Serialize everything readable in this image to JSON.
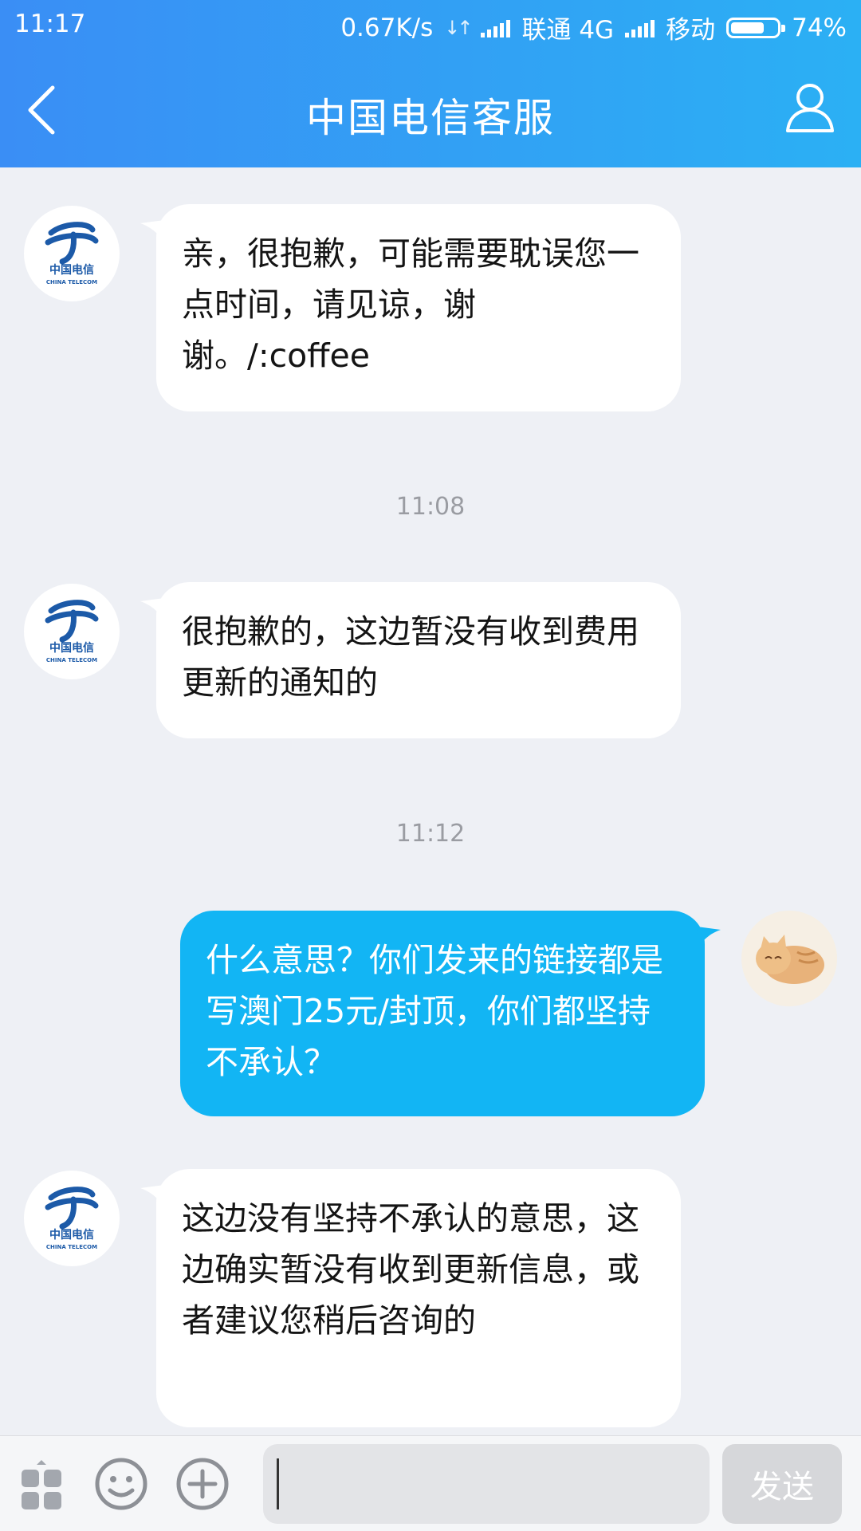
{
  "status_bar": {
    "time": "11:17",
    "network_speed": "0.67K/s",
    "carrier1": "联通 4G",
    "carrier2": "移动",
    "battery": "74%",
    "battery_level": 0.74
  },
  "header": {
    "title": "中国电信客服",
    "back_icon": "chevron-left-icon",
    "profile_icon": "person-outline-icon"
  },
  "agent_logo": {
    "text": "中国电信",
    "sub": "CHINA TELECOM",
    "color": "#1c5aa8"
  },
  "messages": [
    {
      "sender": "agent",
      "text": "亲，很抱歉，可能需要耽误您一点时间，请见谅，谢谢。/:coffee"
    },
    {
      "type": "timestamp",
      "text": "11:08"
    },
    {
      "sender": "agent",
      "text": "很抱歉的，这边暂没有收到费用更新的通知的"
    },
    {
      "type": "timestamp",
      "text": "11:12"
    },
    {
      "sender": "user",
      "text": "什么意思？你们发来的链接都是写澳门25元/封顶，你们都坚持不承认？"
    },
    {
      "sender": "agent",
      "text": "这边没有坚持不承认的意思，这边确实暂没有收到更新信息，或者建议您稍后咨询的"
    }
  ],
  "input_bar": {
    "apps_icon": "apps-grid-icon",
    "emoji_icon": "smiley-icon",
    "plus_icon": "plus-circle-icon",
    "input_value": "",
    "send_label": "发送"
  },
  "colors": {
    "header_start": "#3a8ef5",
    "header_end": "#2bb0f4",
    "user_bubble": "#12b5f4",
    "agent_bubble": "#ffffff",
    "background": "#eef0f5"
  }
}
